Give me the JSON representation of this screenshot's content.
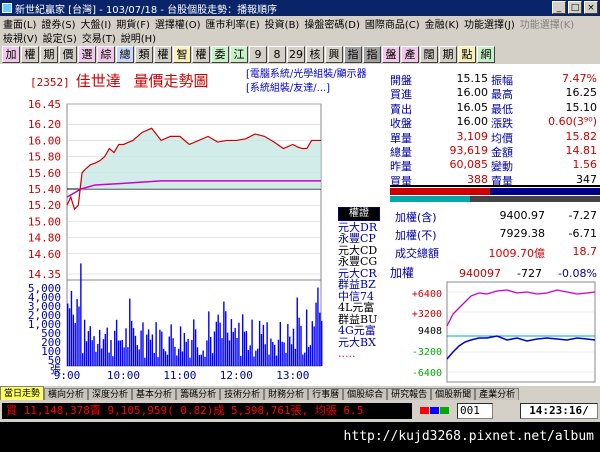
{
  "window": {
    "title": "新世紀贏家 [台灣] - 103/07/18 - 台股個股走勢：播報順序"
  },
  "menu": {
    "row1": [
      "畫面(L)",
      "證券(S)",
      "大盤(I)",
      "期貨(F)",
      "選擇權(O)",
      "匯市利率(E)",
      "投資(B)",
      "操盤密碼(D)",
      "國際商品(C)",
      "金融(K)",
      "功能選擇(J)",
      "功能選擇(K)"
    ],
    "row2": [
      "檢視(V)",
      "設定(S)",
      "交易(T)",
      "說明(H)"
    ]
  },
  "toolbar": [
    "加",
    "權",
    "期",
    "價",
    "選",
    "綜",
    "總",
    "類",
    "權",
    "智",
    "權",
    "委",
    "江",
    "9",
    "8",
    "29",
    "核",
    "興",
    "指",
    "指",
    "盤",
    "產",
    "闊",
    "期",
    "點",
    "網"
  ],
  "stock": {
    "code": "[2352]",
    "name": "佳世達",
    "chart_title": "量價走勢圖"
  },
  "category": {
    "line1": "[電腦系統/光學組裝/顯示器",
    "line2": "[系統組裝/友達/...]"
  },
  "quote": [
    {
      "l1": "開盤",
      "v1": "15.15",
      "l2": "振幅",
      "v2": "7.47%"
    },
    {
      "l1": "買進",
      "v1": "16.00",
      "l2": "最高",
      "v2": "16.25"
    },
    {
      "l1": "賣出",
      "v1": "16.05",
      "l2": "最低",
      "v2": "15.10"
    },
    {
      "l1": "收盤",
      "v1": "16.00",
      "l2": "漲跌",
      "v2": "0.60(3⁹⁰)"
    },
    {
      "l1": "單量",
      "v1": "3,109",
      "l2": "均價",
      "v2": "15.82"
    },
    {
      "l1": "總量",
      "v1": "93,619",
      "l2": "金額",
      "v2": "14.81"
    },
    {
      "l1": "昨量",
      "v1": "60,085",
      "l2": "變動",
      "v2": "1.56"
    },
    {
      "l1": "買量",
      "v1": "388",
      "l2": "賣量",
      "v2": "347"
    }
  ],
  "index": [
    {
      "label": "加權(含)",
      "value": "9400.97",
      "change": "-7.27"
    },
    {
      "label": "加權(不)",
      "value": "7929.38",
      "change": "-6.71"
    },
    {
      "label": "成交總額",
      "value": "1009.70億",
      "change": "18.7"
    }
  ],
  "mini": {
    "title": "加權",
    "price": "9400",
    "price_sup": "97",
    "chg": "-7",
    "chg_sup": "27",
    "pct": "-0.08%",
    "ylabels": [
      "+6400",
      "+3200",
      "9408",
      "24",
      "-3200",
      "-6400"
    ]
  },
  "brokers": {
    "header": "權證",
    "items": [
      "元大DR",
      "永豐CP",
      "元大CD",
      "永豐CG",
      "元大CR",
      "群益BZ",
      "中信74",
      "4L元富",
      "群益BU",
      "4G元富",
      "元大BX",
      "....."
    ]
  },
  "tabs": [
    "當日走勢",
    "橫向分析",
    "深度分析",
    "基本分析",
    "籌碼分析",
    "技術分析",
    "財務分析",
    "行事曆",
    "個股綜合",
    "研究報告",
    "個股新聞",
    "產業分析"
  ],
  "status": {
    "ticker": "買 11,148,378賣 9,105,959( 0.82)成 5,398,761張, 均張 6.5",
    "count": "001",
    "clock": "14:23:16/"
  },
  "watermark": "http://kujd3268.pixnet.net/album",
  "chart_data": {
    "type": "line",
    "title": "量價走勢圖",
    "x_ticks": [
      "9:00",
      "10:00",
      "11:00",
      "12:00",
      "13:00"
    ],
    "price_ticks": [
      "16.45",
      "16.20",
      "16.00",
      "15.80",
      "15.60",
      "15.40",
      "15.20",
      "15.00",
      "14.80",
      "14.60",
      "14.35"
    ],
    "prev_close": 15.4,
    "volume_ticks": [
      "5,000",
      "4,000",
      "3,000",
      "2,000",
      "1,000",
      "500",
      "200",
      "100",
      "50",
      "張"
    ],
    "price_series": {
      "t": [
        0,
        4,
        8,
        12,
        16,
        20,
        25,
        30,
        35,
        40,
        45,
        50,
        55,
        60,
        70,
        80,
        90,
        100,
        110,
        120,
        130,
        140,
        150,
        160,
        170,
        180,
        190,
        200,
        210,
        220,
        230,
        240,
        245,
        250,
        255,
        260,
        265,
        270
      ],
      "v": [
        15.2,
        15.3,
        15.15,
        15.2,
        15.6,
        15.65,
        15.7,
        15.72,
        15.75,
        15.8,
        15.9,
        15.85,
        15.95,
        15.95,
        16.0,
        16.1,
        16.15,
        16.0,
        16.05,
        16.05,
        15.95,
        16.0,
        16.05,
        15.98,
        16.0,
        16.0,
        16.02,
        16.08,
        16.05,
        15.98,
        15.9,
        15.95,
        15.92,
        15.9,
        15.9,
        16.0,
        16.0,
        16.0
      ]
    },
    "avg_price": {
      "t": [
        0,
        15,
        30,
        60,
        100,
        150,
        200,
        270
      ],
      "v": [
        15.3,
        15.4,
        15.45,
        15.47,
        15.5,
        15.5,
        15.5,
        15.5
      ]
    }
  }
}
